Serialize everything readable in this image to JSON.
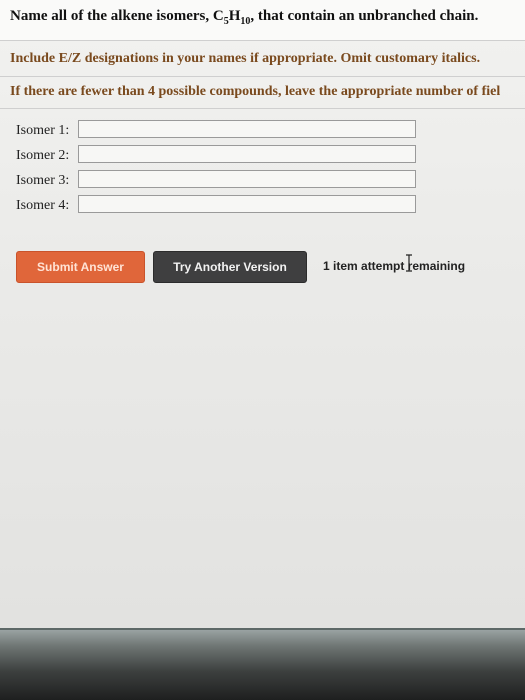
{
  "question": {
    "title_before": "Name all of the alkene isomers, C",
    "title_sub1": "5",
    "title_mid": "H",
    "title_sub2": "10",
    "title_after": ", that contain an unbranched chain.",
    "instruction_1": "Include E/Z designations in your names if appropriate. Omit customary italics.",
    "instruction_2": "If there are fewer than 4 possible compounds, leave the appropriate number of fiel"
  },
  "isomers": [
    {
      "label": "Isomer 1:",
      "value": ""
    },
    {
      "label": "Isomer 2:",
      "value": ""
    },
    {
      "label": "Isomer 3:",
      "value": ""
    },
    {
      "label": "Isomer 4:",
      "value": ""
    }
  ],
  "actions": {
    "submit_label": "Submit Answer",
    "try_label": "Try Another Version",
    "attempts_text": "1 item attempt remaining"
  },
  "colors": {
    "submit": "#e0663a",
    "try": "#3f3f40",
    "instruction": "#7a4a1e"
  }
}
